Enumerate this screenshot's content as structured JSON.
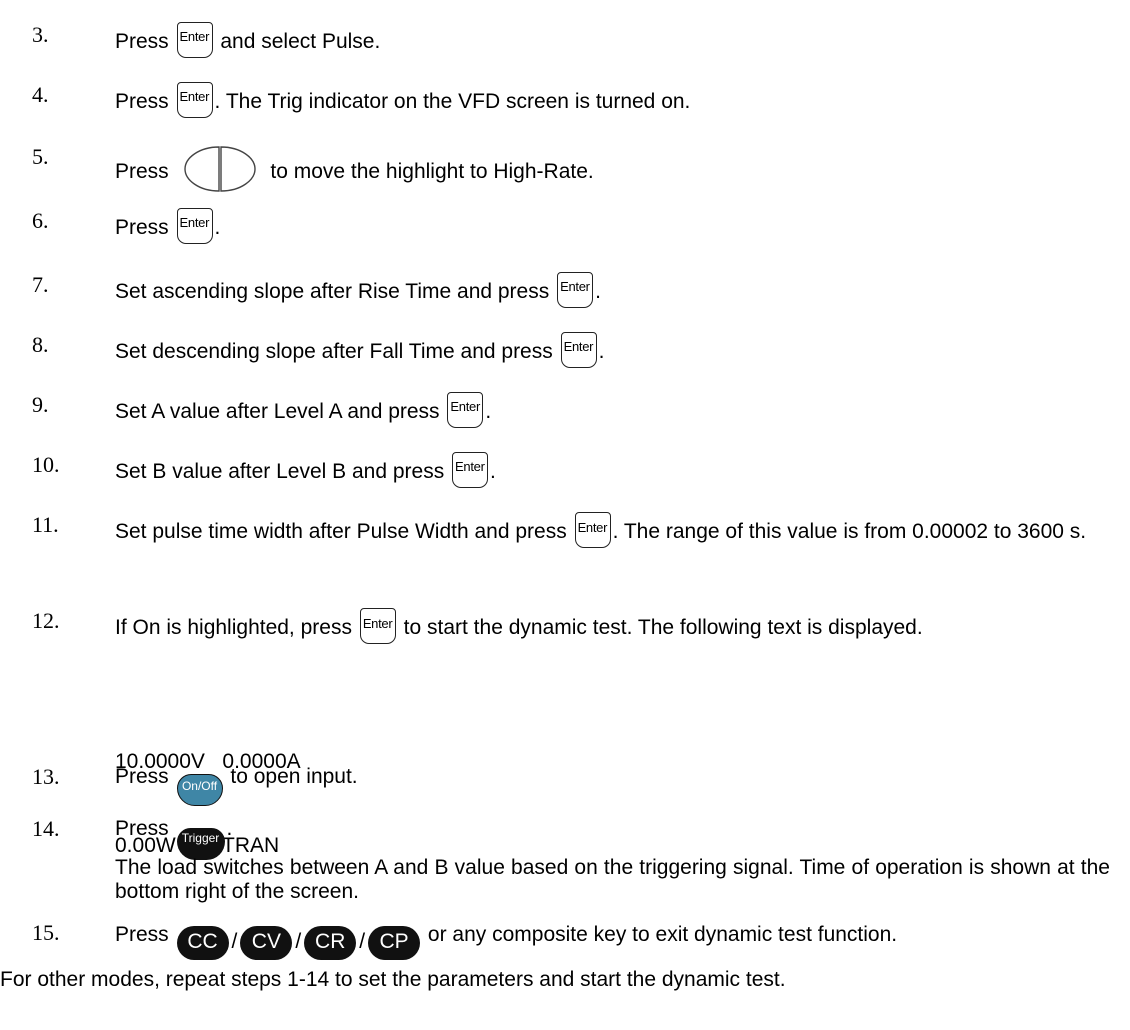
{
  "keys": {
    "enter": "Enter",
    "onoff": "On/Off",
    "trigger": "Trigger",
    "cc": "CC",
    "cv": "CV",
    "cr": "CR",
    "cp": "CP"
  },
  "steps": [
    {
      "num": "3.",
      "pre": "Press",
      "post": "and select Pulse."
    },
    {
      "num": "4.",
      "pre": "Press",
      "post": ". The Trig indicator on the VFD screen is turned on."
    },
    {
      "num": "5.",
      "pre": "Press",
      "post": "to move the highlight to High-Rate."
    },
    {
      "num": "6.",
      "pre": "Press",
      "post": "."
    },
    {
      "num": "7.",
      "pre": "Set ascending slope after Rise Time and press",
      "post": "."
    },
    {
      "num": "8.",
      "pre": "Set descending slope after Fall Time and press",
      "post": "."
    },
    {
      "num": "9.",
      "pre": "Set A value after Level A and press",
      "post": "."
    },
    {
      "num": "10.",
      "pre": "Set B value after Level B and press",
      "post": "."
    },
    {
      "num": "11.",
      "pre": "Set pulse time width after Pulse Width and press",
      "post": ". The range of this value is from 0.00002 to 3600 s."
    },
    {
      "num": "12.",
      "pre": "If On is highlighted, press",
      "post": "to start the dynamic test. The following text is displayed."
    },
    {
      "num": "13.",
      "pre": "Press",
      "post": "to open input."
    },
    {
      "num": "14.",
      "pre": "Press",
      "post": "."
    },
    {
      "num": "15.",
      "pre": "Press",
      "post": "or any composite key to exit dynamic test function."
    }
  ],
  "display": {
    "line1": "10.0000V   0.0000A",
    "line2": "0.00W     0 TRAN"
  },
  "step14_detail": "The load switches between A and B value based on the triggering signal. Time of operation is shown at the bottom right of the screen.",
  "slash": "/",
  "footer_note": "For other modes, repeat steps 1-14 to set the parameters and start the dynamic test."
}
